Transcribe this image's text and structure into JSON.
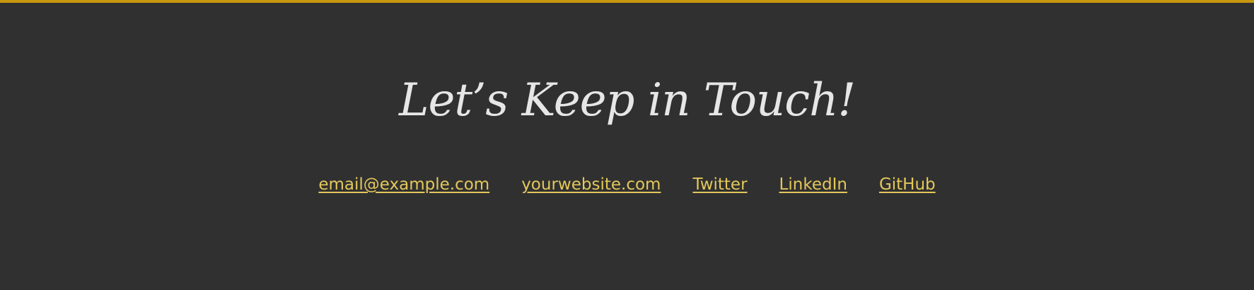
{
  "footer": {
    "title": "Let’s Keep in Touch!",
    "links": [
      {
        "label": "email@example.com"
      },
      {
        "label": "yourwebsite.com"
      },
      {
        "label": "Twitter"
      },
      {
        "label": "LinkedIn"
      },
      {
        "label": "GitHub"
      }
    ]
  },
  "colors": {
    "background": "#303030",
    "accent_border": "#c8960f",
    "title_text": "#e6e6e6",
    "link_text": "#e3c75b"
  }
}
